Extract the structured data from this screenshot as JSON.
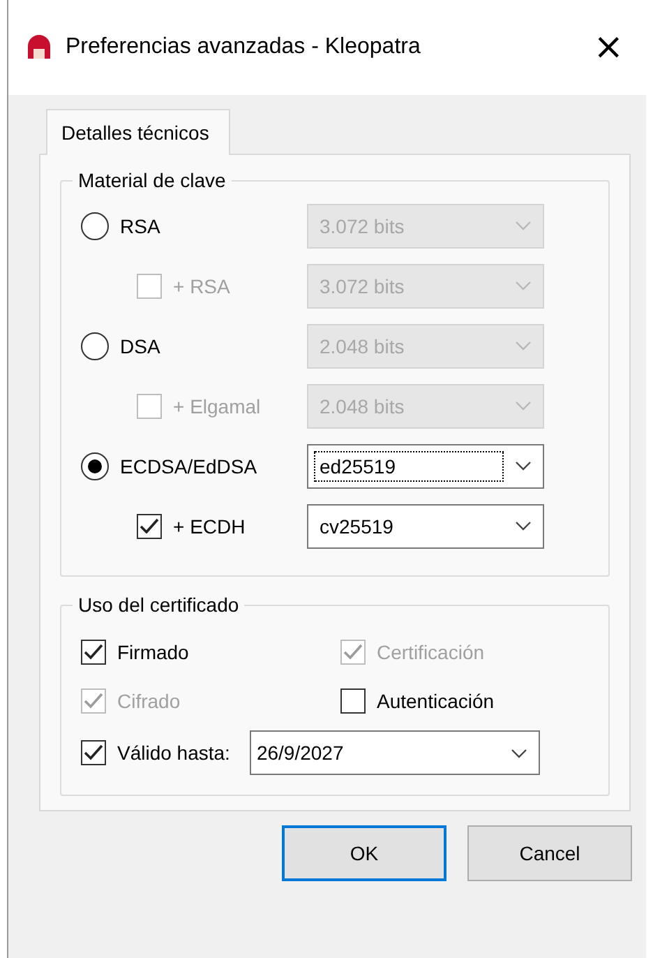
{
  "window": {
    "title": "Preferencias avanzadas - Kleopatra",
    "close": "×"
  },
  "tabs": [
    {
      "label": "Detalles técnicos",
      "selected": true
    }
  ],
  "key_material": {
    "title": "Material de clave",
    "rows": [
      {
        "kind": "radio",
        "label": "RSA",
        "selected": false,
        "combo": {
          "value": "3.072 bits",
          "disabled": true,
          "focused": false
        }
      },
      {
        "kind": "checkbox",
        "label": "+ RSA",
        "checked": false,
        "disabled": true,
        "combo": {
          "value": "3.072 bits",
          "disabled": true,
          "focused": false
        }
      },
      {
        "kind": "radio",
        "label": "DSA",
        "selected": false,
        "combo": {
          "value": "2.048 bits",
          "disabled": true,
          "focused": false
        }
      },
      {
        "kind": "checkbox",
        "label": "+ Elgamal",
        "checked": false,
        "disabled": true,
        "combo": {
          "value": "2.048 bits",
          "disabled": true,
          "focused": false
        }
      },
      {
        "kind": "radio",
        "label": "ECDSA/EdDSA",
        "selected": true,
        "combo": {
          "value": "ed25519",
          "disabled": false,
          "focused": true
        }
      },
      {
        "kind": "checkbox",
        "label": "+ ECDH",
        "checked": true,
        "disabled": false,
        "combo": {
          "value": "cv25519",
          "disabled": false,
          "focused": false
        }
      }
    ]
  },
  "usage": {
    "title": "Uso del certificado",
    "options": [
      {
        "label": "Firmado",
        "checked": true,
        "disabled": false
      },
      {
        "label": "Certificación",
        "checked": true,
        "disabled": true
      },
      {
        "label": "Cifrado",
        "checked": true,
        "disabled": true
      },
      {
        "label": "Autenticación",
        "checked": false,
        "disabled": false
      }
    ],
    "valid_until": {
      "label": "Válido hasta:",
      "checked": true,
      "value": "26/9/2027"
    }
  },
  "buttons": [
    {
      "label": "OK",
      "default": true
    },
    {
      "label": "Cancel",
      "default": false
    }
  ]
}
